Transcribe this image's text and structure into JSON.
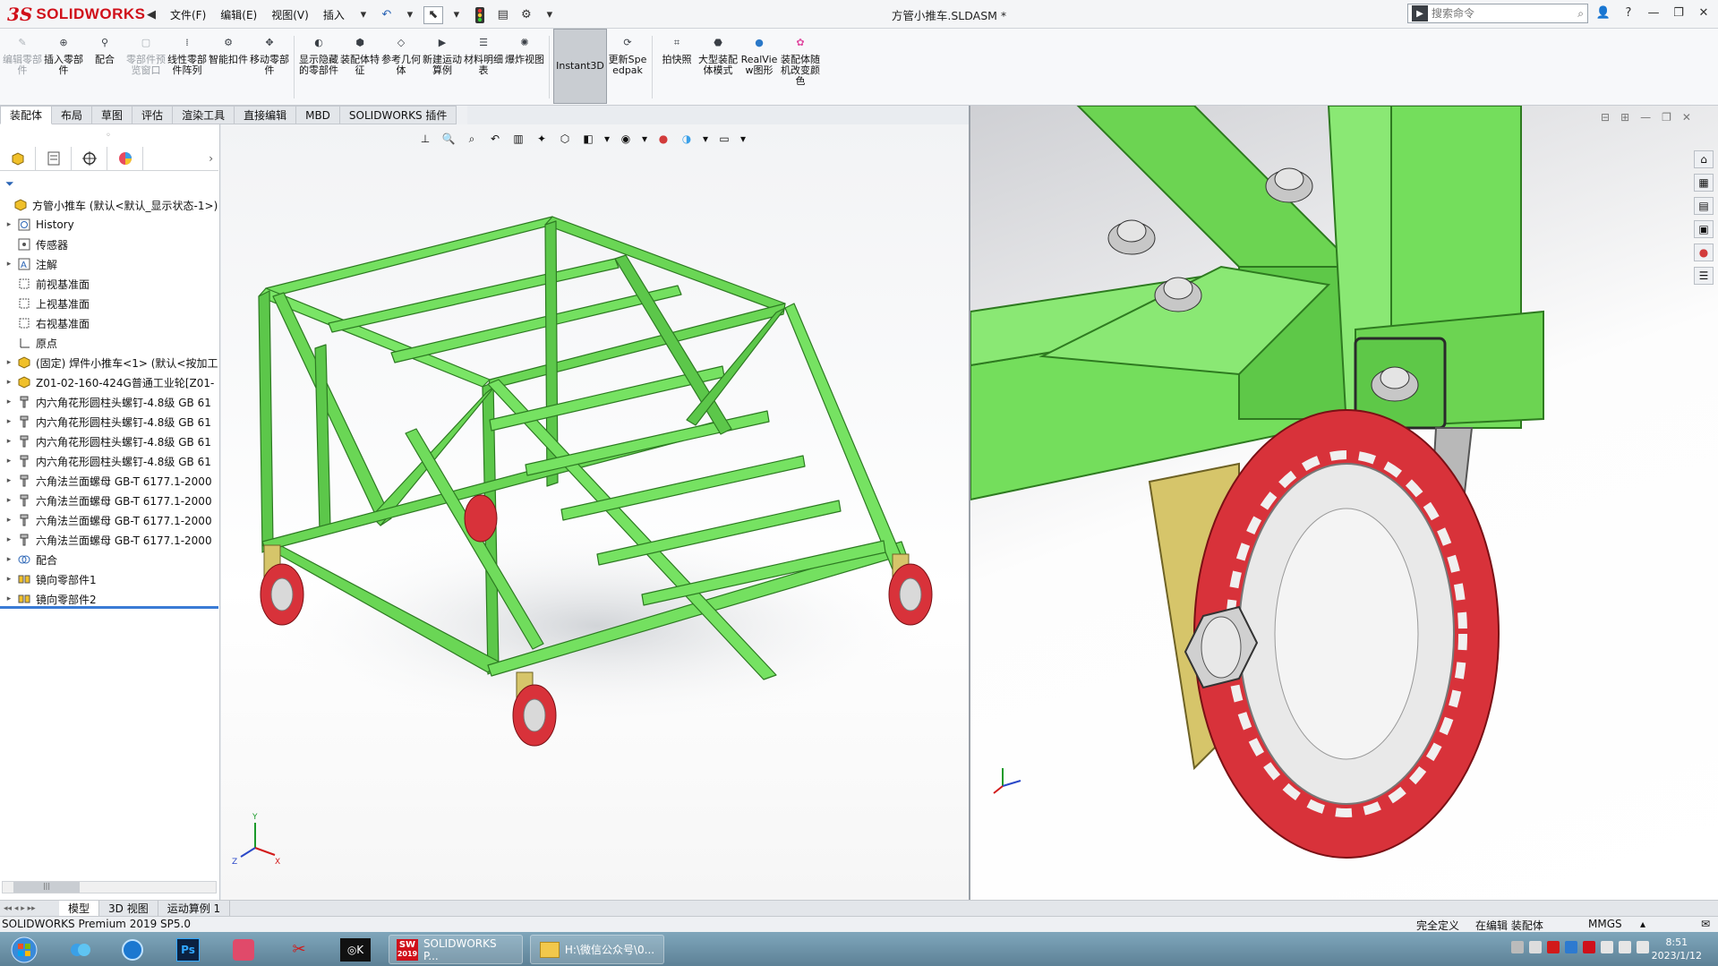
{
  "app": {
    "name": "SOLIDWORKS",
    "doc_title": "方管小推车.SLDASM *"
  },
  "menu": {
    "file": "文件(F)",
    "edit": "编辑(E)",
    "view": "视图(V)",
    "insert": "插入"
  },
  "search": {
    "placeholder": "搜索命令"
  },
  "ribbon": [
    {
      "label": "编辑零部件",
      "disabled": true,
      "icon": "edit-component-icon"
    },
    {
      "label": "插入零部件",
      "disabled": false,
      "icon": "insert-component-icon"
    },
    {
      "label": "配合",
      "disabled": false,
      "icon": "mate-icon"
    },
    {
      "label": "零部件预览窗口",
      "disabled": true,
      "icon": "preview-window-icon"
    },
    {
      "label": "线性零部件阵列",
      "disabled": false,
      "icon": "linear-pattern-icon"
    },
    {
      "label": "智能扣件",
      "disabled": false,
      "icon": "smart-fastener-icon"
    },
    {
      "label": "移动零部件",
      "disabled": false,
      "icon": "move-component-icon"
    },
    {
      "label": "显示隐藏的零部件",
      "disabled": false,
      "icon": "show-hidden-icon"
    },
    {
      "label": "装配体特征",
      "disabled": false,
      "icon": "assembly-feature-icon"
    },
    {
      "label": "参考几何体",
      "disabled": false,
      "icon": "reference-geometry-icon"
    },
    {
      "label": "新建运动算例",
      "disabled": false,
      "icon": "motion-study-icon"
    },
    {
      "label": "材料明细表",
      "disabled": false,
      "icon": "bom-icon"
    },
    {
      "label": "爆炸视图",
      "disabled": false,
      "icon": "exploded-view-icon"
    },
    {
      "label": "Instant3D",
      "disabled": false,
      "icon": "instant3d-icon",
      "active": true
    },
    {
      "label": "更新Speedpak",
      "disabled": false,
      "icon": "speedpak-icon"
    },
    {
      "label": "拍快照",
      "disabled": false,
      "icon": "snapshot-icon"
    },
    {
      "label": "大型装配体模式",
      "disabled": false,
      "icon": "large-assembly-icon"
    },
    {
      "label": "RealView图形",
      "disabled": false,
      "icon": "realview-icon"
    },
    {
      "label": "装配体随机改变颜色",
      "disabled": false,
      "icon": "random-color-icon"
    }
  ],
  "tabs": [
    "装配体",
    "布局",
    "草图",
    "评估",
    "渲染工具",
    "直接编辑",
    "MBD",
    "SOLIDWORKS 插件"
  ],
  "tree": [
    {
      "label": "方管小推车  (默认<默认_显示状态-1>)",
      "expander": "",
      "icon": "assembly-icon",
      "indent": 0
    },
    {
      "label": "History",
      "expander": "▸",
      "icon": "history-icon",
      "indent": 1
    },
    {
      "label": "传感器",
      "expander": "",
      "icon": "sensor-icon",
      "indent": 1
    },
    {
      "label": "注解",
      "expander": "▸",
      "icon": "annotation-icon",
      "indent": 1
    },
    {
      "label": "前视基准面",
      "expander": "",
      "icon": "plane-icon",
      "indent": 1
    },
    {
      "label": "上视基准面",
      "expander": "",
      "icon": "plane-icon",
      "indent": 1
    },
    {
      "label": "右视基准面",
      "expander": "",
      "icon": "plane-icon",
      "indent": 1
    },
    {
      "label": "原点",
      "expander": "",
      "icon": "origin-icon",
      "indent": 1
    },
    {
      "label": "(固定) 焊件小推车<1> (默认<按加工",
      "expander": "▸",
      "icon": "part-icon",
      "indent": 1
    },
    {
      "label": "Z01-02-160-424G普通工业轮[Z01-",
      "expander": "▸",
      "icon": "part-icon",
      "indent": 1
    },
    {
      "label": "内六角花形圆柱头螺钉-4.8级 GB 61",
      "expander": "▸",
      "icon": "screw-icon",
      "indent": 1
    },
    {
      "label": "内六角花形圆柱头螺钉-4.8级 GB 61",
      "expander": "▸",
      "icon": "screw-icon",
      "indent": 1
    },
    {
      "label": "内六角花形圆柱头螺钉-4.8级 GB 61",
      "expander": "▸",
      "icon": "screw-icon",
      "indent": 1
    },
    {
      "label": "内六角花形圆柱头螺钉-4.8级 GB 61",
      "expander": "▸",
      "icon": "screw-icon",
      "indent": 1
    },
    {
      "label": "六角法兰面螺母 GB-T 6177.1-2000",
      "expander": "▸",
      "icon": "screw-icon",
      "indent": 1
    },
    {
      "label": "六角法兰面螺母 GB-T 6177.1-2000",
      "expander": "▸",
      "icon": "screw-icon",
      "indent": 1
    },
    {
      "label": "六角法兰面螺母 GB-T 6177.1-2000",
      "expander": "▸",
      "icon": "screw-icon",
      "indent": 1
    },
    {
      "label": "六角法兰面螺母 GB-T 6177.1-2000",
      "expander": "▸",
      "icon": "screw-icon",
      "indent": 1
    },
    {
      "label": "配合",
      "expander": "▸",
      "icon": "mate-icon",
      "indent": 1
    },
    {
      "label": "镜向零部件1",
      "expander": "▸",
      "icon": "mirror-icon",
      "indent": 1
    },
    {
      "label": "镜向零部件2",
      "expander": "▸",
      "icon": "mirror-icon",
      "indent": 1
    }
  ],
  "bottom_tabs": [
    "模型",
    "3D 视图",
    "运动算例 1"
  ],
  "status": {
    "product": "SOLIDWORKS Premium 2019 SP5.0",
    "state": "完全定义",
    "mode": "在编辑 装配体",
    "units": "MMGS"
  },
  "taskbar": {
    "sw_label": "SOLIDWORKS P...",
    "folder_label": "H:\\微信公众号\\0...",
    "sw_badge": "2019",
    "time": "8:51",
    "date": "2023/1/12"
  },
  "triad": {
    "x": "X",
    "y": "Y",
    "z": "Z"
  },
  "colors": {
    "frame_green": "#6ddc5b",
    "wheel_red": "#d8323a",
    "brand_red": "#d0101a"
  }
}
